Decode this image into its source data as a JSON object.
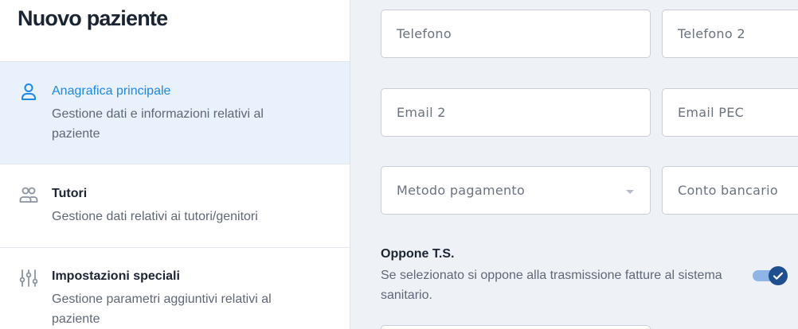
{
  "sidebar": {
    "title": "Nuovo paziente",
    "items": [
      {
        "label": "Anagrafica principale",
        "description": "Gestione dati e informazioni relativi al paziente",
        "icon": "user-icon",
        "active": true
      },
      {
        "label": "Tutori",
        "description": "Gestione dati relativi ai tutori/genitori",
        "icon": "users-icon",
        "active": false
      },
      {
        "label": "Impostazioni speciali",
        "description": "Gestione parametri aggiuntivi relativi al paziente",
        "icon": "sliders-icon",
        "active": false
      }
    ]
  },
  "form": {
    "telefono_placeholder": "Telefono",
    "telefono2_placeholder": "Telefono 2",
    "email2_placeholder": "Email 2",
    "email_pec_placeholder": "Email PEC",
    "metodo_pagamento_placeholder": "Metodo pagamento",
    "conto_bancario_placeholder": "Conto bancario",
    "oppone_ts": {
      "title": "Oppone T.S.",
      "description": "Se selezionato si oppone alla trasmissione fatture al sistema sanitario.",
      "checked": true
    }
  },
  "colors": {
    "accent": "#1e88e5",
    "active_bg": "#e9f1fd",
    "toggle_knob": "#1e4f8f"
  }
}
